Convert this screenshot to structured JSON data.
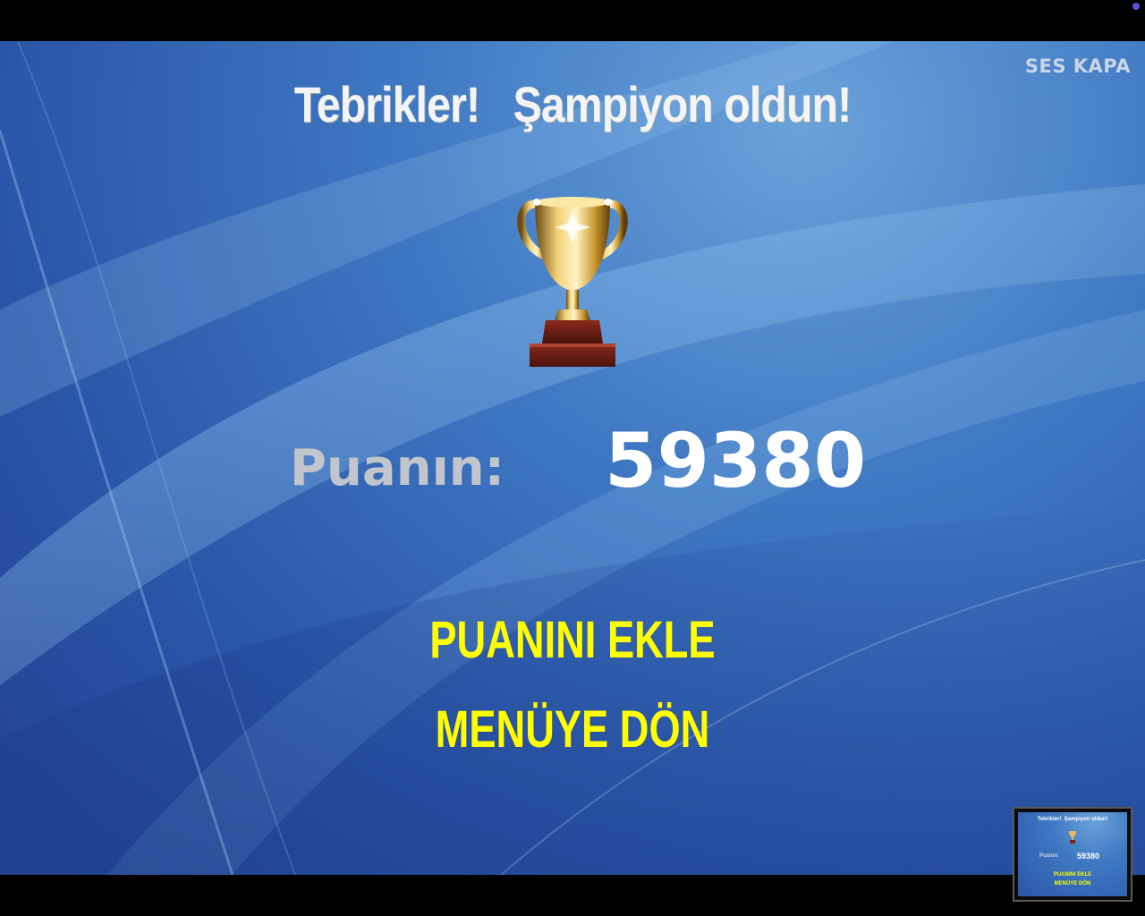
{
  "window": {
    "status_dot_color": "#5a4fd8"
  },
  "header": {
    "mute_label": "SES KAPA"
  },
  "main": {
    "title": "Tebrikler!   Şampiyon oldun!",
    "trophy_icon": "trophy-icon",
    "score_label": "Puanın:",
    "score_value": "59380",
    "add_score_button": "PUANINI EKLE",
    "menu_button": "MENÜYE DÖN"
  },
  "colors": {
    "button_text": "#ffff00",
    "title_text": "#f4f4f4",
    "score_label": "#c2c6cc",
    "background_blue": "#3f78c2"
  },
  "thumbnail": {
    "title": "Tebrikler!  Şampiyon oldun!",
    "score_label": "Puanın:",
    "score_value": "59380",
    "add_score_button": "PUANINI EKLE",
    "menu_button": "MENÜYE DÖN"
  }
}
